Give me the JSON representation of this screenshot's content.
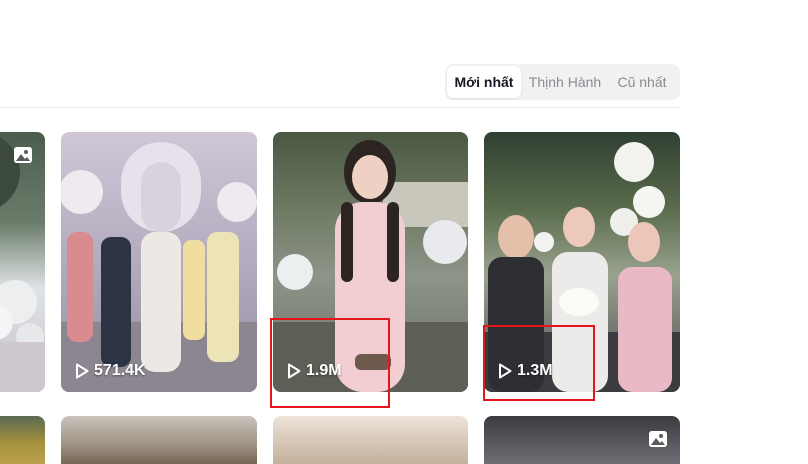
{
  "sort_tabs": [
    {
      "label": "Mới nhất",
      "active": true
    },
    {
      "label": "Thịnh Hành",
      "active": false
    },
    {
      "label": "Cũ nhất",
      "active": false
    }
  ],
  "videos": [
    {
      "views": "571.4K"
    },
    {
      "views": "1.9M"
    },
    {
      "views": "1.3M"
    }
  ],
  "icons": {
    "play": "play-icon",
    "photo": "photo-icon"
  },
  "colors": {
    "highlight": "#e4161c",
    "active_tab_text": "#161823",
    "inactive_tab_text": "#8a8b91"
  }
}
